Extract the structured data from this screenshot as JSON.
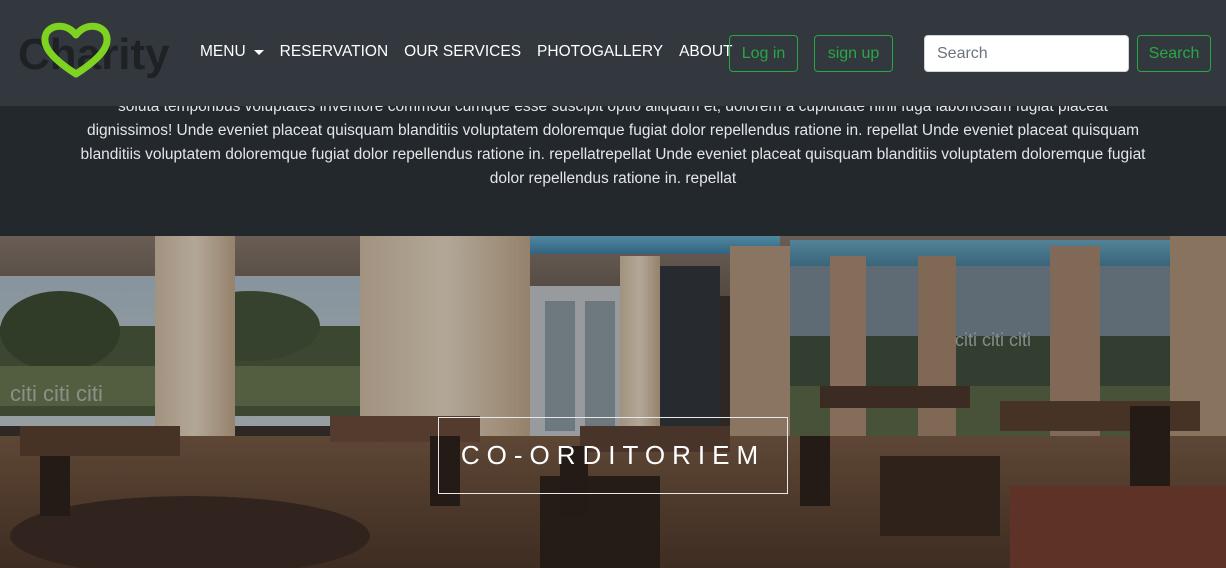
{
  "intro": {
    "text": "soluta temporibus voluptates inventore commodi cumque esse suscipit optio aliquam et, dolorem a cupiditate nihil fuga laboriosam fugiat placeat dignissimos! Unde eveniet placeat quisquam blanditiis voluptatem doloremque fugiat dolor repellendus ratione in. repellat Unde eveniet placeat quisquam blanditiis voluptatem doloremque fugiat dolor repellendus ratione in. repellatrepellat Unde eveniet placeat quisquam blanditiis voluptatem doloremque fugiat dolor repellendus ratione in. repellat"
  },
  "navbar": {
    "logo_text": "Charity",
    "links": [
      "MENU",
      "RESERVATION",
      "OUR SERVICES",
      "PHOTOGALLERY",
      "ABOUT"
    ],
    "login_label": "Log in",
    "signup_label": "sign up",
    "search_placeholder": "Search",
    "search_button_label": "Search"
  },
  "hero": {
    "title": "CO-ORDITORIEM",
    "window_text": "citi citi citi"
  },
  "colors": {
    "navbar_bg": "#33383e",
    "section_bg": "#23282d",
    "accent_green": "#28a745",
    "logo_heart_green": "#7ed321"
  }
}
